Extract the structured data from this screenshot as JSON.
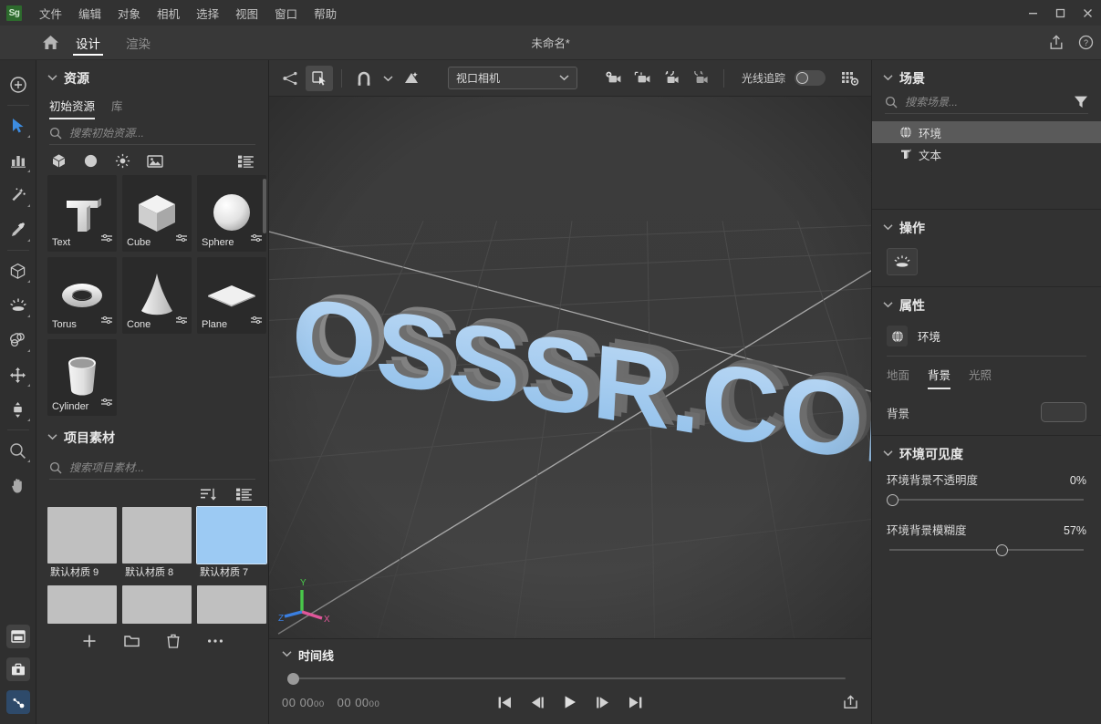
{
  "window": {
    "app_logo": "Sg",
    "title": "未命名*",
    "minimize": "–",
    "maximize": "□",
    "close": "✕"
  },
  "menubar": {
    "items": [
      {
        "label": "文件",
        "name": "menu-file"
      },
      {
        "label": "编辑",
        "name": "menu-edit"
      },
      {
        "label": "对象",
        "name": "menu-object"
      },
      {
        "label": "相机",
        "name": "menu-camera"
      },
      {
        "label": "选择",
        "name": "menu-select"
      },
      {
        "label": "视图",
        "name": "menu-view"
      },
      {
        "label": "窗口",
        "name": "menu-window"
      },
      {
        "label": "帮助",
        "name": "menu-help"
      }
    ]
  },
  "tabbar": {
    "home_icon": "home-icon",
    "tabs": [
      {
        "label": "设计",
        "active": true
      },
      {
        "label": "渲染",
        "active": false
      }
    ],
    "share_icon": "share-icon",
    "help_icon": "help-circle-icon"
  },
  "toolrail": {
    "add": "plus-circle-icon",
    "tools": [
      "select-arrow-icon",
      "transform-bars-icon",
      "magic-wand-icon",
      "eyedropper-icon",
      "cube-icon",
      "light-icon",
      "material-icon",
      "move-icon",
      "scale-icon",
      "zoom-icon",
      "pan-hand-icon"
    ],
    "bottom": [
      "window-icon",
      "toolbox-icon",
      "nodes-icon"
    ]
  },
  "assets": {
    "section_title": "资源",
    "tabs": [
      {
        "label": "初始资源",
        "active": true
      },
      {
        "label": "库",
        "active": false
      }
    ],
    "search_placeholder": "搜索初始资源...",
    "filters": [
      "cube-filter-icon",
      "material-filter-icon",
      "light-filter-icon",
      "image-filter-icon"
    ],
    "list_view_icon": "list-view-icon",
    "items": [
      {
        "label": "Text",
        "shape": "text"
      },
      {
        "label": "Cube",
        "shape": "cube"
      },
      {
        "label": "Sphere",
        "shape": "sphere"
      },
      {
        "label": "Torus",
        "shape": "torus"
      },
      {
        "label": "Cone",
        "shape": "cone"
      },
      {
        "label": "Plane",
        "shape": "plane"
      },
      {
        "label": "Cylinder",
        "shape": "cylinder"
      }
    ]
  },
  "project_materials": {
    "section_title": "项目素材",
    "search_placeholder": "搜索项目素材...",
    "sort_icon": "sort-icon",
    "list_view_icon": "list-view-icon",
    "items": [
      {
        "label": "默认材质 9",
        "color": "#c0c0c0",
        "selected": false
      },
      {
        "label": "默认材质 8",
        "color": "#c0c0c0",
        "selected": false
      },
      {
        "label": "默认材质 7",
        "color": "#9ccaf3",
        "selected": true
      },
      {
        "label": "",
        "color": "#c0c0c0",
        "selected": false
      },
      {
        "label": "",
        "color": "#c0c0c0",
        "selected": false
      },
      {
        "label": "",
        "color": "#c0c0c0",
        "selected": false
      }
    ],
    "footer": [
      "add-icon",
      "folder-icon",
      "trash-icon",
      "more-icon"
    ]
  },
  "viewport_toolbar": {
    "buttons": [
      "object-move-icon",
      "snap-to-object-icon"
    ],
    "magnet_icon": "magnet-icon",
    "magnet_chevron": "chevron-down-icon",
    "light-place-icon": "light-place-icon",
    "camera_select": {
      "value": "视口相机",
      "chevron": "▾"
    },
    "camera_buttons": [
      "add-camera-icon",
      "frame-camera-icon",
      "camera-undo-icon",
      "camera-redo-icon"
    ],
    "raytrace_label": "光线追踪",
    "raytrace_on": false,
    "render_settings_icon": "render-settings-icon"
  },
  "viewport": {
    "text_3d": "OSSSR.COM",
    "text_color": "#9dc8f0",
    "background": "#3a3a3a",
    "axis": {
      "x": "X",
      "y": "Y",
      "z": "Z",
      "x_color": "#e0569a",
      "y_color": "#49c84a",
      "z_color": "#3a7fe0"
    }
  },
  "timeline": {
    "title": "时间线",
    "current_time": "00 0000",
    "total_time": "00 0000",
    "time_a_main": "00 00",
    "time_a_frames": "00",
    "time_b_main": "00 00",
    "time_b_frames": "00",
    "transport": [
      "skip-start-icon",
      "step-back-icon",
      "play-icon",
      "step-forward-icon",
      "skip-end-icon"
    ],
    "export_icon": "export-icon",
    "playhead_percent": 0
  },
  "scene": {
    "section_title": "场景",
    "search_placeholder": "搜索场景...",
    "filter_icon": "funnel-icon",
    "items": [
      {
        "label": "环境",
        "icon": "globe-icon",
        "selected": true
      },
      {
        "label": "文本",
        "icon": "text-object-icon",
        "selected": false
      }
    ]
  },
  "actions": {
    "section_title": "操作",
    "buttons": [
      {
        "icon": "environment-light-icon"
      }
    ]
  },
  "properties": {
    "section_title": "属性",
    "object_icon": "globe-icon",
    "object_name": "环境",
    "tabs": [
      {
        "label": "地面",
        "active": false
      },
      {
        "label": "背景",
        "active": true
      },
      {
        "label": "光照",
        "active": false
      }
    ],
    "background_label": "背景",
    "background_swatch_color": "#3b3b3b"
  },
  "environment_visibility": {
    "section_title": "环境可见度",
    "sliders": [
      {
        "label": "环境背景不透明度",
        "value": "0%",
        "percent": 0
      },
      {
        "label": "环境背景模糊度",
        "value": "57%",
        "percent": 57
      }
    ]
  }
}
